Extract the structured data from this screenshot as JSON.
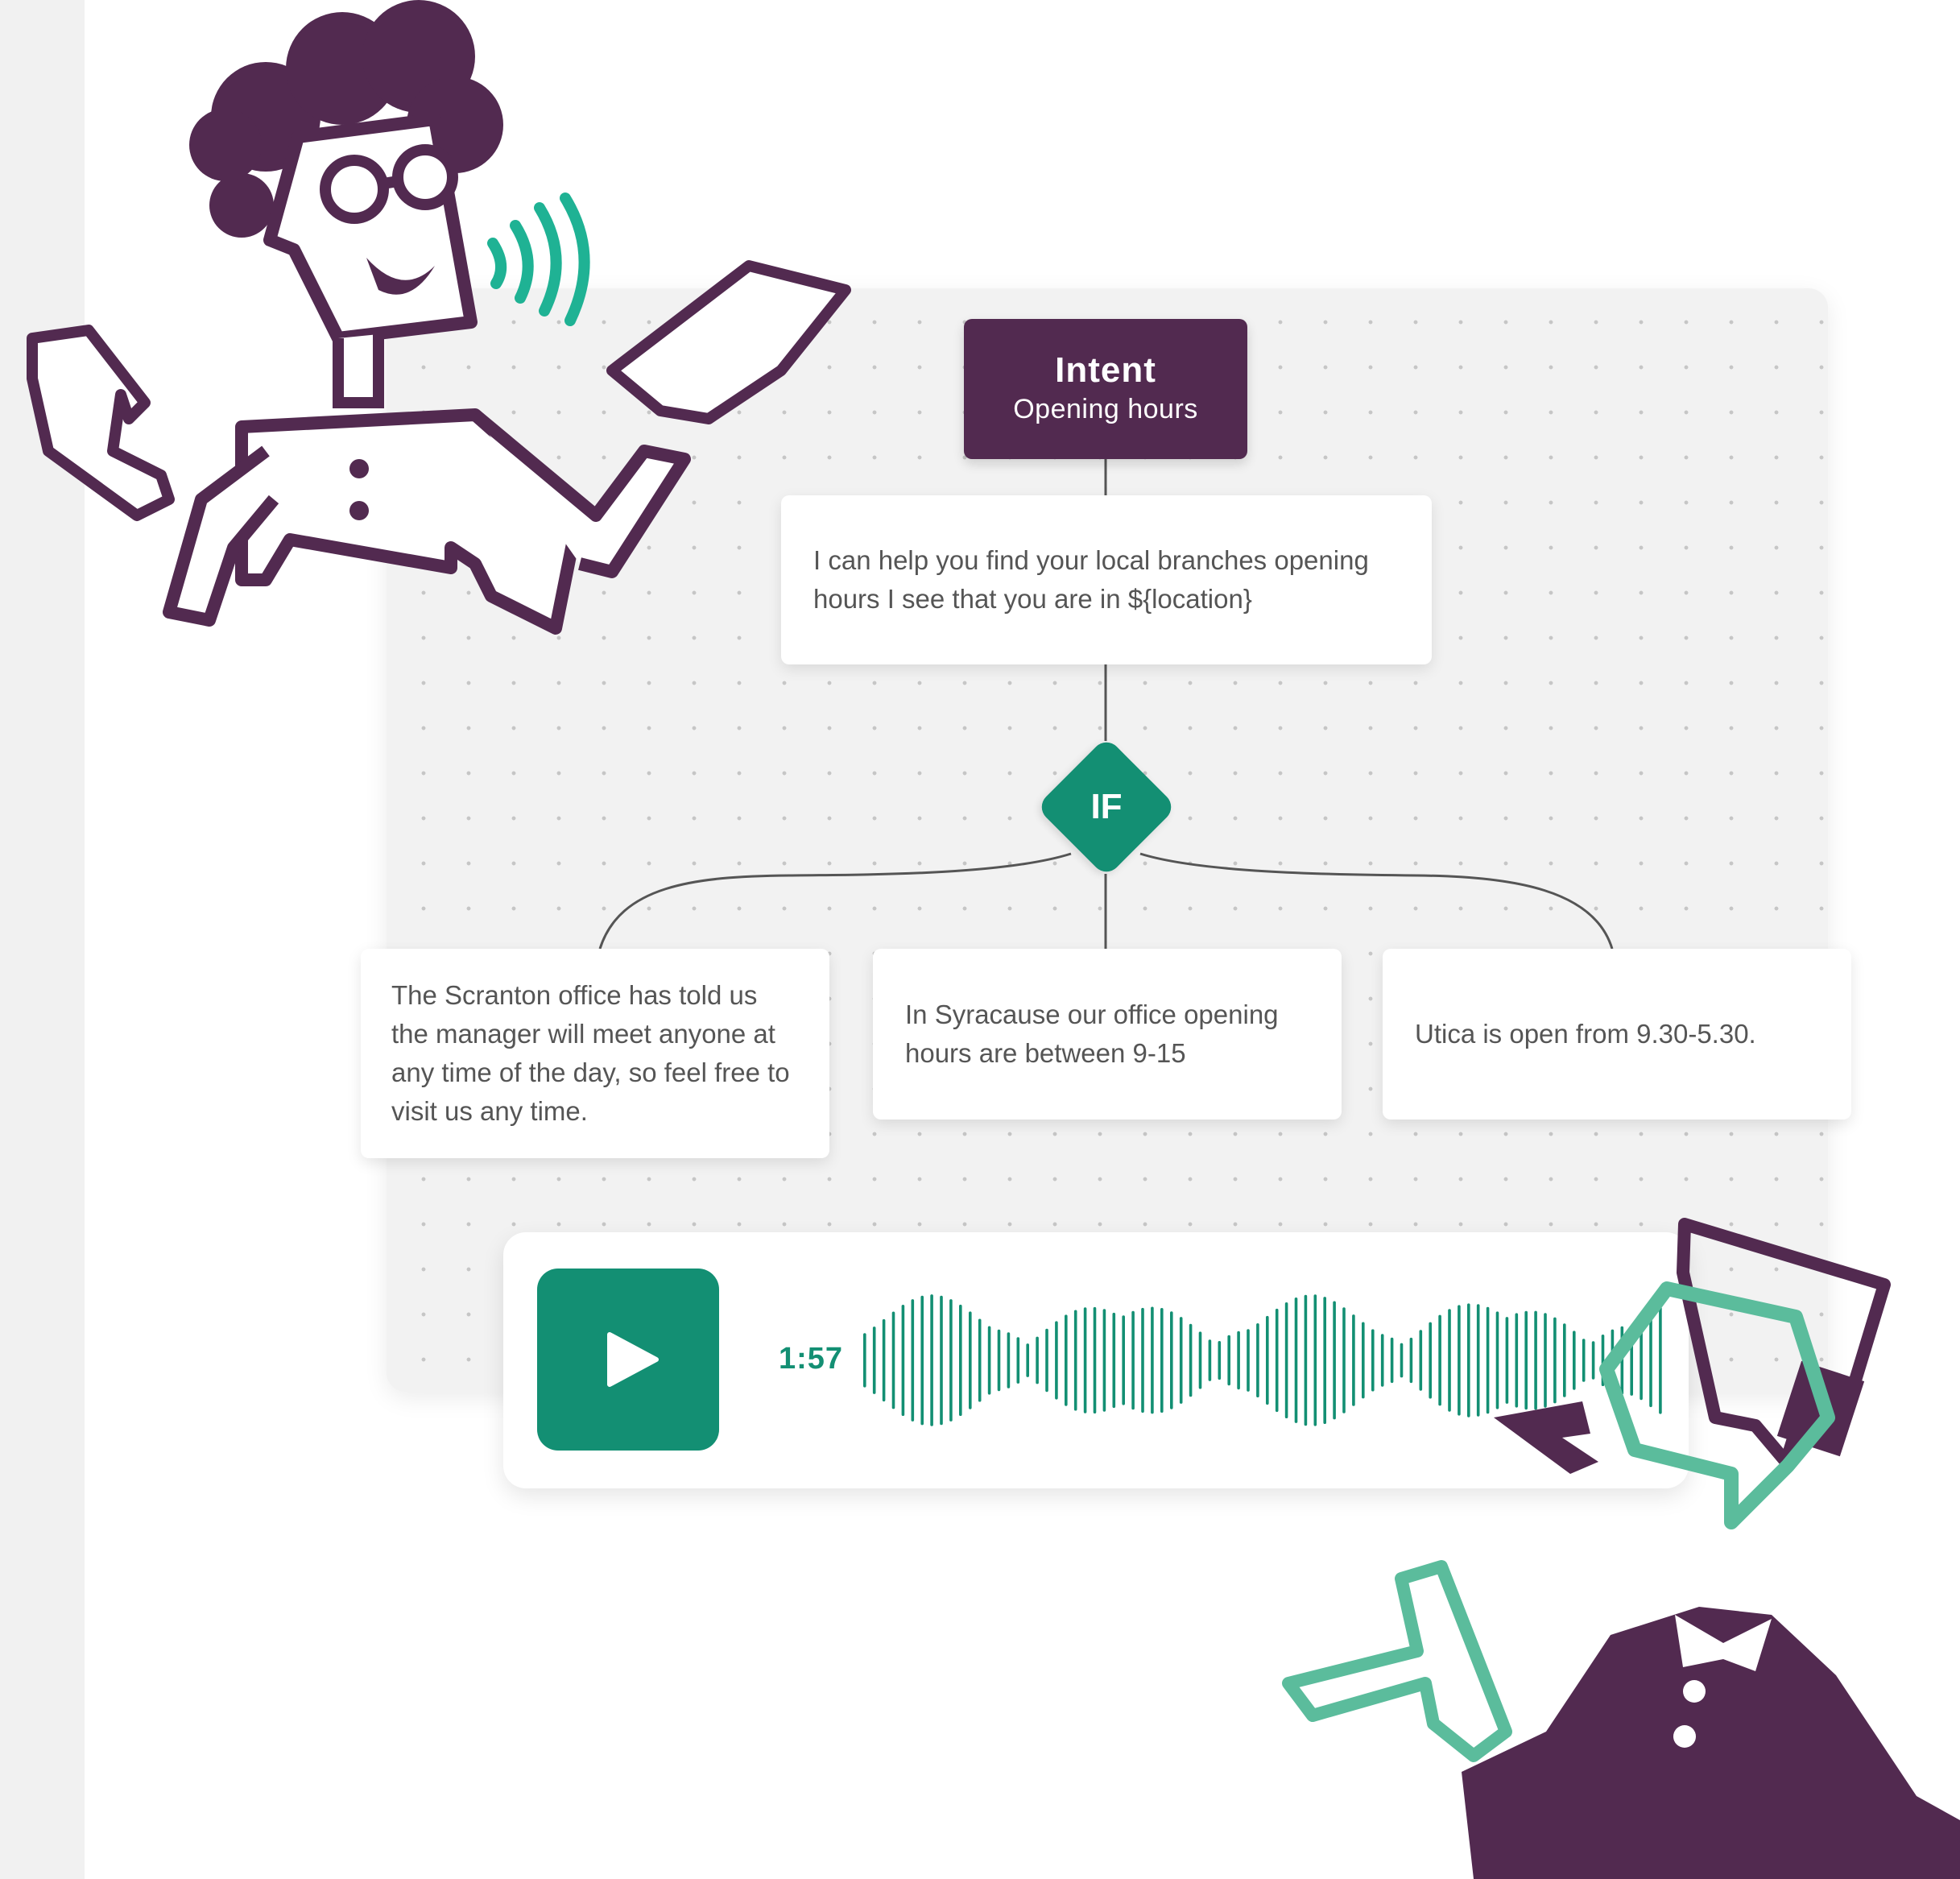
{
  "flow": {
    "intent": {
      "title": "Intent",
      "subtitle": "Opening hours"
    },
    "response_message": "I can help you find your local branches opening hours I see that you are in ${location}",
    "condition_label": "IF",
    "branches": [
      {
        "text": "The Scranton office has told us the manager will meet anyone at any time of the day, so feel free to visit us any time."
      },
      {
        "text": "In Syracause our office opening hours are between 9-15"
      },
      {
        "text": "Utica is open from 9.30-5.30."
      }
    ]
  },
  "audio_player": {
    "duration": "1:57",
    "play_icon": "play-icon"
  },
  "colors": {
    "brand_purple": "#522a50",
    "brand_green": "#138f73",
    "accent_mint": "#5bbc9c",
    "canvas_bg": "#f2f2f2"
  }
}
